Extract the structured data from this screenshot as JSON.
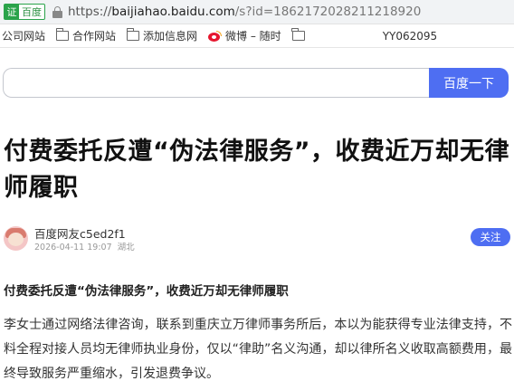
{
  "address_bar": {
    "cert_badge": "证",
    "cert_label": "百度",
    "url_scheme": "https://",
    "url_domain": "baijiahao.baidu.com",
    "url_rest": "/s?id=1862172028211218920"
  },
  "bookmarks": {
    "items": [
      {
        "label": "公司网站",
        "icon": "folder-icon"
      },
      {
        "label": "合作网站",
        "icon": "folder-icon"
      },
      {
        "label": "添加信息网",
        "icon": "folder-icon"
      },
      {
        "label": "微博 – 随时",
        "icon": "weibo-icon"
      },
      {
        "label": "",
        "icon": "folder-icon"
      },
      {
        "label": "YY062095",
        "icon": ""
      }
    ]
  },
  "search": {
    "placeholder": "",
    "button_label": "百度一下"
  },
  "article": {
    "title": "付费委托反遭“伪法律服务”，收费近万却无律师履职",
    "author_name": "百度网友c5ed2f1",
    "publish_time": "2026-04-11 19:07",
    "location": "湖北",
    "follow_label": "关注",
    "subtitle": "付费委托反遭“伪法律服务”，收费近万却无律师履职",
    "paragraph": "李女士通过网络法律咨询，联系到重庆立万律师事务所后，本以为能获得专业法律支持，不料全程对接人员均无律师执业身份，仅以“律助”名义沟通，却以律所名义收取高额费用，最终导致服务严重缩水，引发退费争议。"
  },
  "colors": {
    "accent": "#4e6ef2",
    "cert_green": "#2aa34a",
    "weibo_red": "#e6162d"
  }
}
